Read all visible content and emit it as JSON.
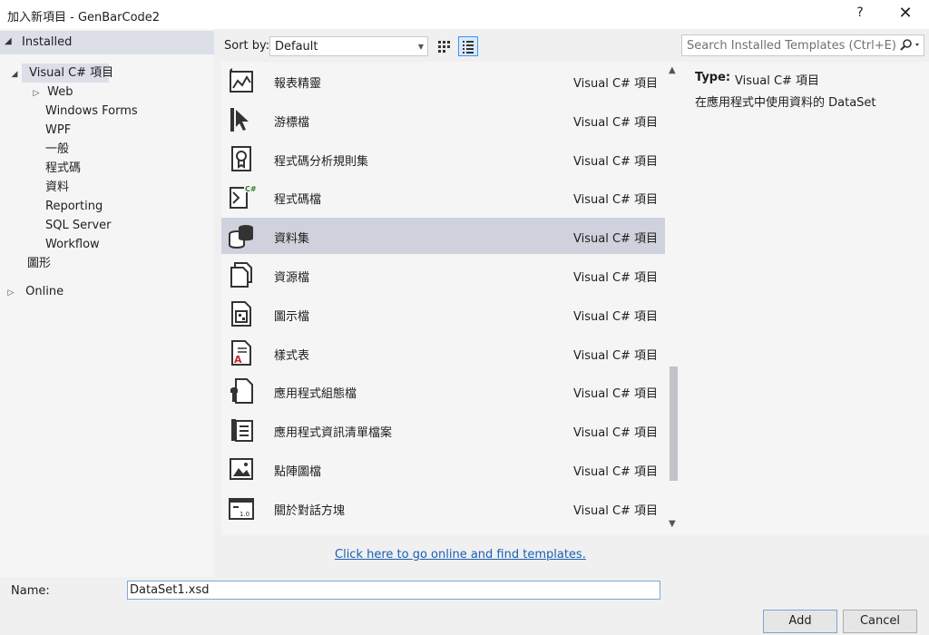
{
  "window": {
    "title": "加入新項目 - GenBarCode2",
    "help_label": "?",
    "close_label": "✕"
  },
  "tree": {
    "installed": "Installed",
    "visual_csharp": "Visual C# 項目",
    "web": "Web",
    "windows_forms": "Windows Forms",
    "wpf": "WPF",
    "general": "一般",
    "code": "程式碼",
    "data": "資料",
    "reporting": "Reporting",
    "sql_server": "SQL Server",
    "workflow": "Workflow",
    "graphics": "圖形",
    "online": "Online"
  },
  "toolbar": {
    "sort_label": "Sort by:",
    "sort_value": "Default",
    "search_placeholder": "Search Installed Templates (Ctrl+E)"
  },
  "templates": [
    {
      "name": "報表精靈",
      "category": "Visual C# 項目",
      "icon": "report-wizard-icon",
      "selected": false
    },
    {
      "name": "游標檔",
      "category": "Visual C# 項目",
      "icon": "cursor-icon",
      "selected": false
    },
    {
      "name": "程式碼分析規則集",
      "category": "Visual C# 項目",
      "icon": "ruleset-icon",
      "selected": false
    },
    {
      "name": "程式碼檔",
      "category": "Visual C# 項目",
      "icon": "code-file-icon",
      "selected": false
    },
    {
      "name": "資料集",
      "category": "Visual C# 項目",
      "icon": "dataset-icon",
      "selected": true
    },
    {
      "name": "資源檔",
      "category": "Visual C# 項目",
      "icon": "resource-file-icon",
      "selected": false
    },
    {
      "name": "圖示檔",
      "category": "Visual C# 項目",
      "icon": "icon-file-icon",
      "selected": false
    },
    {
      "name": "樣式表",
      "category": "Visual C# 項目",
      "icon": "stylesheet-icon",
      "selected": false
    },
    {
      "name": "應用程式組態檔",
      "category": "Visual C# 項目",
      "icon": "config-file-icon",
      "selected": false
    },
    {
      "name": "應用程式資訊清單檔案",
      "category": "Visual C# 項目",
      "icon": "manifest-icon",
      "selected": false
    },
    {
      "name": "點陣圖檔",
      "category": "Visual C# 項目",
      "icon": "bitmap-icon",
      "selected": false
    },
    {
      "name": "關於對話方塊",
      "category": "Visual C# 項目",
      "icon": "about-box-icon",
      "selected": false
    }
  ],
  "details": {
    "type_label": "Type:",
    "type_value": "Visual C# 項目",
    "description": "在應用程式中使用資料的 DataSet"
  },
  "online_link": "Click here to go online and find templates.",
  "footer": {
    "name_label": "Name:",
    "name_value": "DataSet1.xsd",
    "add_label": "Add",
    "cancel_label": "Cancel"
  },
  "colors": {
    "selected_row": "#cfd1dc",
    "link": "#1a5fb4",
    "panel": "#f5f5f5"
  }
}
